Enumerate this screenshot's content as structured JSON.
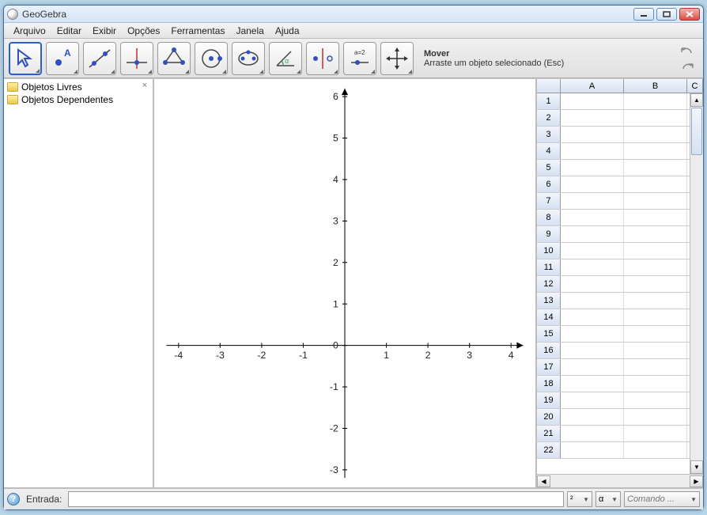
{
  "window": {
    "title": "GeoGebra"
  },
  "menu": {
    "items": [
      "Arquivo",
      "Editar",
      "Exibir",
      "Opções",
      "Ferramentas",
      "Janela",
      "Ajuda"
    ]
  },
  "toolbar": {
    "help_title": "Mover",
    "help_desc": "Arraste um objeto selecionado (Esc)"
  },
  "algebra": {
    "folders": [
      "Objetos Livres",
      "Objetos Dependentes"
    ]
  },
  "spreadsheet": {
    "cols": [
      "A",
      "B",
      "C"
    ],
    "rows": 22
  },
  "inputbar": {
    "label": "Entrada:",
    "sel1": "²",
    "sel2": "α",
    "command_placeholder": "Comando ..."
  },
  "chart_data": {
    "type": "scatter",
    "series": [],
    "x": [],
    "y": [],
    "title": "",
    "xlabel": "",
    "ylabel": "",
    "xlim": [
      -4,
      4
    ],
    "ylim": [
      -3,
      6
    ],
    "x_ticks": [
      -4,
      -3,
      -2,
      -1,
      0,
      1,
      2,
      3,
      4
    ],
    "y_ticks": [
      -3,
      -2,
      -1,
      0,
      1,
      2,
      3,
      4,
      5,
      6
    ],
    "grid": false
  }
}
